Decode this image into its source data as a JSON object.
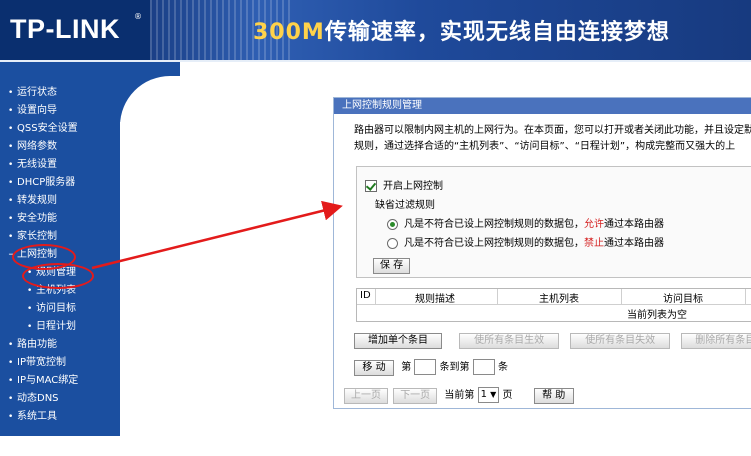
{
  "header": {
    "brand": "TP-LINK",
    "brand_mark": "®",
    "slogan_highlight": "300M",
    "slogan_rest": "传输速率，实现无线自由连接梦想"
  },
  "sidebar": {
    "items": [
      {
        "label": "运行状态",
        "sub": false
      },
      {
        "label": "设置向导",
        "sub": false
      },
      {
        "label": "QSS安全设置",
        "sub": false
      },
      {
        "label": "网络参数",
        "sub": false
      },
      {
        "label": "无线设置",
        "sub": false
      },
      {
        "label": "DHCP服务器",
        "sub": false
      },
      {
        "label": "转发规则",
        "sub": false
      },
      {
        "label": "安全功能",
        "sub": false
      },
      {
        "label": "家长控制",
        "sub": false
      },
      {
        "label": "上网控制",
        "sub": false
      },
      {
        "label": "规则管理",
        "sub": true
      },
      {
        "label": "主机列表",
        "sub": true
      },
      {
        "label": "访问目标",
        "sub": true
      },
      {
        "label": "日程计划",
        "sub": true
      },
      {
        "label": "路由功能",
        "sub": false
      },
      {
        "label": "IP带宽控制",
        "sub": false
      },
      {
        "label": "IP与MAC绑定",
        "sub": false
      },
      {
        "label": "动态DNS",
        "sub": false
      },
      {
        "label": "系统工具",
        "sub": false
      }
    ]
  },
  "panel": {
    "title": "上网控制规则管理",
    "desc_line1": "路由器可以限制内网主机的上网行为。在本页面，您可以打开或者关闭此功能，并且设定默认",
    "desc_line2": "规则，通过选择合适的“主机列表”、“访问目标”、“日程计划”，构成完整而又强大的上",
    "enable_label": "开启上网控制",
    "default_rule_label": "缺省过滤规则",
    "radio1_pre": "凡是不符合已设上网控制规则的数据包，",
    "radio1_key": "允许",
    "radio1_post": "通过本路由器",
    "radio2_pre": "凡是不符合已设上网控制规则的数据包，",
    "radio2_key": "禁止",
    "radio2_post": "通过本路由器",
    "save_button": "保 存",
    "table": {
      "columns": [
        "ID",
        "规则描述",
        "主机列表",
        "访问目标"
      ],
      "empty_text": "当前列表为空"
    },
    "buttons": {
      "add": "增加单个条目",
      "enable_all": "使所有条目生效",
      "disable_all": "使所有条目失效",
      "delete_all": "删除所有条目"
    },
    "move": {
      "button": "移 动",
      "prefix": "第",
      "middle": "条到第",
      "suffix": "条"
    },
    "pager": {
      "prev": "上一页",
      "next": "下一页",
      "current_label": "当前第",
      "current_value": "1",
      "page_suffix": "页",
      "help": "帮 助"
    }
  },
  "annotation_color": "#e31b1b"
}
